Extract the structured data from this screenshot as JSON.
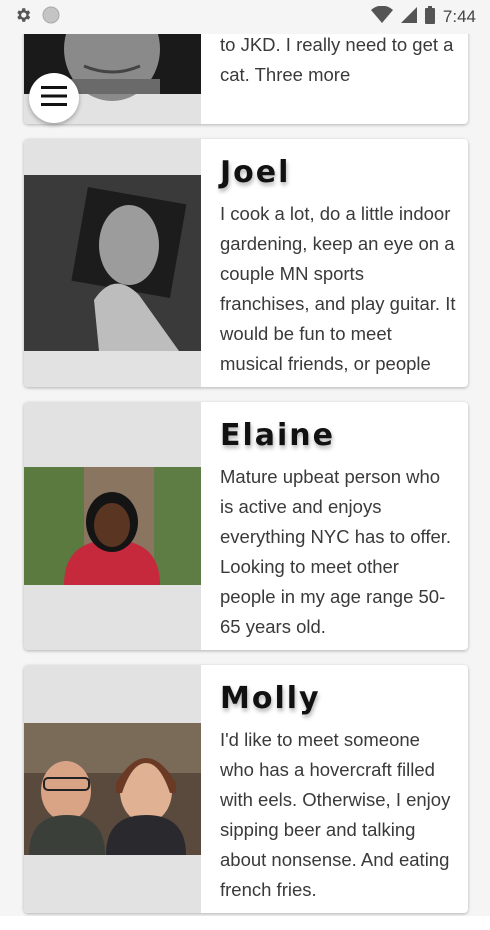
{
  "status_bar": {
    "time": "7:44"
  },
  "menu": {
    "icon": "hamburger-menu-icon"
  },
  "cards": [
    {
      "name": "",
      "bio": "sleep. Can't wait to get back to JKD. I really need to get a cat. Three more"
    },
    {
      "name": "Joel",
      "bio": "I cook a lot, do a little indoor gardening, keep an eye on a couple MN sports franchises, and play guitar. It would be fun to meet musical friends, or people"
    },
    {
      "name": "Elaine",
      "bio": "Mature upbeat person who is active and enjoys everything NYC has to offer. Looking to meet other people in my age range 50-65 years old."
    },
    {
      "name": "Molly",
      "bio": "I'd like to meet someone who has a hovercraft filled with eels. Otherwise, I enjoy sipping beer and talking about nonsense. And eating french fries."
    }
  ]
}
